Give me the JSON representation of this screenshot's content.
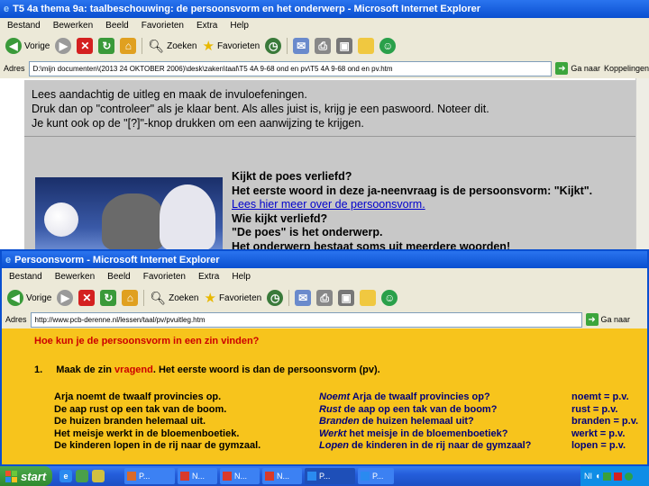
{
  "back_window": {
    "title": "T5 4a thema 9a: taalbeschouwing: de persoonsvorm en het onderwerp - Microsoft Internet Explorer",
    "menu": [
      "Bestand",
      "Bewerken",
      "Beeld",
      "Favorieten",
      "Extra",
      "Help"
    ],
    "toolbar": {
      "back": "Vorige",
      "search": "Zoeken",
      "favorites": "Favorieten"
    },
    "address_label": "Adres",
    "address": "D:\\mijn documenten\\(2013 24 OKTOBER 2006)\\desk\\zaken\\taal\\T5 4A 9-68 ond en pv\\T5 4A 9-68 ond en pv.htm",
    "go_label": "Ga naar",
    "links_label": "Koppelingen",
    "instructions": [
      "Lees aandachtig de uitleg en maak de invuloefeningen.",
      "Druk dan op \"controleer\" als je klaar bent. Als alles juist is, krijg je een paswoord. Noteer dit.",
      "Je kunt ook op de \"[?]\"-knop drukken om een aanwijzing te krijgen."
    ],
    "lesson": {
      "line1": "Kijkt de poes verliefd?",
      "line2": "Het eerste woord in deze ja-neenvraag is de persoonsvorm: \"Kijkt\".",
      "link": "Lees hier meer over de persoonsvorm.",
      "line3": "Wie kijkt verliefd?",
      "line4": "\"De poes\" is het onderwerp.",
      "line5": "Het onderwerp bestaat soms uit meerdere woorden!"
    }
  },
  "front_window": {
    "title": "Persoonsvorm - Microsoft Internet Explorer",
    "menu": [
      "Bestand",
      "Bewerken",
      "Beeld",
      "Favorieten",
      "Extra",
      "Help"
    ],
    "toolbar": {
      "back": "Vorige",
      "search": "Zoeken",
      "favorites": "Favorieten"
    },
    "address_label": "Adres",
    "address": "http://www.pcb-derenne.nl/lessen/taal/pv/pvuitleg.htm",
    "go_label": "Ga naar",
    "question": "Hoe kun je de persoonsvorm in een zin vinden?",
    "step_num": "1.",
    "step_pre": "Maak de zin ",
    "step_keyword": "vragend",
    "step_post": ". Het eerste woord is dan de persoonsvorm (pv).",
    "rows": [
      {
        "sentence": "Arja noemt de twaalf provincies op.",
        "q_verb": "Noemt",
        "q_rest": " Arja de twaalf provincies op?",
        "answer": "noemt = p.v."
      },
      {
        "sentence": "De aap rust op een tak van de boom.",
        "q_verb": "Rust",
        "q_rest": " de aap op een tak van de boom?",
        "answer": "rust = p.v."
      },
      {
        "sentence": "De huizen branden helemaal uit.",
        "q_verb": "Branden",
        "q_rest": " de huizen helemaal uit?",
        "answer": "branden = p.v."
      },
      {
        "sentence": "Het meisje werkt in de bloemenboetiek.",
        "q_verb": "Werkt",
        "q_rest": " het meisje in de bloemenboetiek?",
        "answer": "werkt = p.v."
      },
      {
        "sentence": "De kinderen lopen in de rij naar de gymzaal.",
        "q_verb": "Lopen",
        "q_rest": " de kinderen in de rij naar de gymzaal?",
        "answer": "lopen = p.v."
      }
    ]
  },
  "taskbar": {
    "start": "start",
    "tasks": [
      "P...",
      "N...",
      "N...",
      "N...",
      "P...",
      "P..."
    ],
    "tray_text": "NI"
  },
  "colors": {
    "titlebar": "#0a5fe0",
    "chrome": "#ece9d8",
    "back_page_bg": "#c8c8c8",
    "front_page_bg": "#f7c41c",
    "heading_red": "#cc0000",
    "link_blue": "#0000cc",
    "answer_navy": "#00007a",
    "taskbar": "#245edb",
    "start_green": "#3c8f3c"
  }
}
